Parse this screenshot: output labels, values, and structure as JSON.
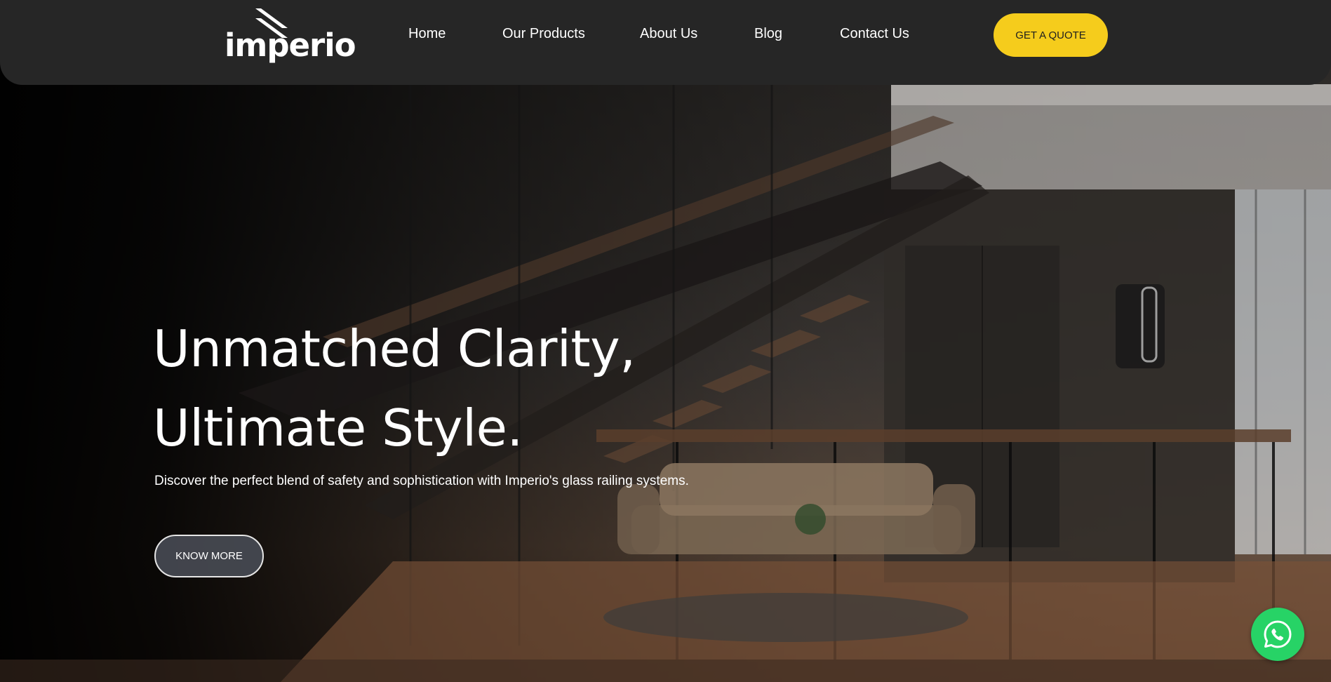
{
  "brand": {
    "logo_text": "imperio",
    "logo_icon": "double-slash-icon"
  },
  "nav": {
    "items": [
      {
        "label": "Home"
      },
      {
        "label": "Our Products"
      },
      {
        "label": "About Us"
      },
      {
        "label": "Blog"
      },
      {
        "label": "Contact Us"
      }
    ],
    "cta_label": "GET A QUOTE"
  },
  "hero": {
    "headline_line1": "Unmatched Clarity,",
    "headline_line2": "Ultimate Style.",
    "subtext": "Discover the perfect blend of safety and sophistication with Imperio's glass railing systems.",
    "cta_label": "KNOW MORE"
  },
  "floating": {
    "whatsapp_icon": "whatsapp-icon"
  },
  "colors": {
    "header_bg": "#262626",
    "accent_yellow": "#f5cc1c",
    "whatsapp_green": "#27d366",
    "text": "#ffffff"
  }
}
